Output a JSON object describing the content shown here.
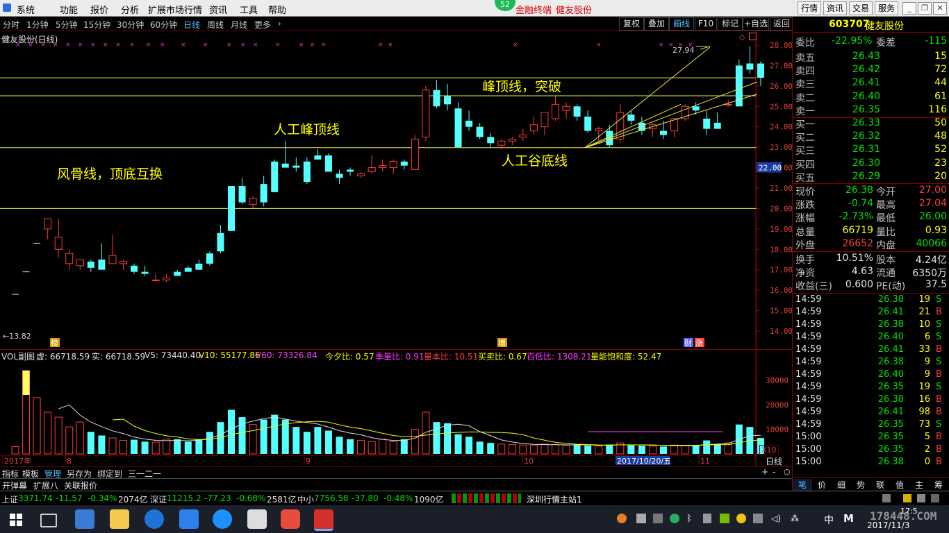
{
  "menu": {
    "items": [
      "系统",
      "功能",
      "报价",
      "分析",
      "扩展市场行情",
      "资讯",
      "工具",
      "帮助"
    ],
    "badge": "52",
    "center_items": [
      "金融终端",
      "健友股份"
    ],
    "right_buttons": [
      "行情",
      "资讯",
      "交易",
      "服务"
    ]
  },
  "period_bar": {
    "items": [
      "分时",
      "1分钟",
      "5分钟",
      "15分钟",
      "30分钟",
      "60分钟",
      "日线",
      "周线",
      "月线",
      "更多"
    ],
    "active": "日线",
    "right_buttons": [
      "复权",
      "叠加",
      "画线",
      "F10",
      "标记",
      "+自选",
      "返回"
    ]
  },
  "chart": {
    "title": "健友股份(日线)",
    "high_label": "27.94",
    "low_label": "13.82",
    "current_price_tag": "22.00",
    "price_axis": [
      "28.00",
      "27.00",
      "26.00",
      "25.00",
      "24.00",
      "23.00",
      "22.00",
      "21.00",
      "20.00",
      "19.00",
      "18.00",
      "17.00",
      "16.00",
      "15.00",
      "14.00"
    ],
    "annotations": [
      "人工峰顶线",
      "峰顶线，突破",
      "人工谷底线",
      "风骨线，顶底互换"
    ],
    "marker_labels": [
      "榜",
      "增",
      "财",
      "涨"
    ]
  },
  "chart_data": {
    "type": "candlestick",
    "price_range": [
      13.82,
      28.3
    ],
    "candles": [
      [
        15.8,
        15.8,
        15.8,
        15.8
      ],
      [
        16.9,
        16.9,
        16.9,
        16.9
      ],
      [
        18.3,
        18.3,
        18.3,
        18.3
      ],
      [
        19.0,
        19.5,
        18.5,
        19.5
      ],
      [
        18.0,
        19.5,
        17.6,
        18.6
      ],
      [
        17.3,
        18.0,
        17.0,
        17.8
      ],
      [
        17.2,
        17.5,
        17.0,
        17.5
      ],
      [
        17.4,
        17.5,
        16.9,
        17.1
      ],
      [
        17.5,
        18.3,
        17.2,
        17.0
      ],
      [
        17.3,
        18.7,
        17.3,
        17.7
      ],
      [
        17.3,
        17.5,
        17.0,
        17.4
      ],
      [
        17.2,
        17.3,
        16.8,
        16.9
      ],
      [
        16.9,
        17.2,
        16.7,
        16.8
      ],
      [
        16.5,
        16.8,
        16.4,
        16.5
      ],
      [
        16.5,
        16.8,
        16.4,
        16.6
      ],
      [
        16.9,
        17.0,
        16.7,
        16.7
      ],
      [
        17.1,
        17.2,
        16.9,
        16.9
      ],
      [
        17.3,
        17.5,
        17.0,
        17.0
      ],
      [
        17.8,
        17.9,
        17.2,
        17.3
      ],
      [
        18.8,
        19.2,
        17.8,
        17.9
      ],
      [
        21.1,
        21.1,
        18.9,
        18.9
      ],
      [
        21.1,
        21.5,
        20.2,
        20.3
      ],
      [
        20.2,
        20.6,
        20.0,
        20.5
      ],
      [
        21.2,
        21.6,
        20.1,
        20.3
      ],
      [
        22.3,
        22.4,
        20.8,
        20.8
      ],
      [
        22.2,
        23.3,
        22.0,
        22.0
      ],
      [
        22.1,
        22.5,
        21.8,
        22.0
      ],
      [
        22.3,
        22.5,
        21.2,
        21.3
      ],
      [
        22.6,
        22.9,
        22.4,
        22.4
      ],
      [
        22.6,
        22.7,
        21.8,
        21.8
      ],
      [
        21.7,
        21.9,
        21.2,
        21.5
      ],
      [
        21.9,
        22.0,
        21.6,
        21.8
      ],
      [
        21.6,
        21.8,
        21.5,
        21.7
      ],
      [
        21.8,
        22.6,
        21.7,
        22.0
      ],
      [
        22.0,
        22.4,
        21.8,
        22.1
      ],
      [
        22.0,
        22.4,
        21.7,
        22.3
      ],
      [
        22.3,
        22.4,
        21.9,
        22.1
      ],
      [
        21.9,
        23.6,
        21.9,
        23.4
      ],
      [
        23.5,
        26.0,
        23.3,
        25.8
      ],
      [
        25.8,
        26.3,
        24.9,
        25.0
      ],
      [
        25.5,
        26.1,
        24.8,
        25.1
      ],
      [
        24.9,
        25.2,
        23.9,
        23.0
      ],
      [
        24.3,
        24.8,
        23.8,
        24.0
      ],
      [
        24.0,
        24.2,
        23.4,
        23.5
      ],
      [
        23.5,
        23.7,
        23.0,
        23.2
      ],
      [
        23.1,
        23.4,
        22.9,
        23.3
      ],
      [
        23.3,
        23.5,
        23.1,
        23.4
      ],
      [
        23.5,
        23.9,
        23.3,
        23.6
      ],
      [
        23.8,
        24.5,
        23.6,
        24.1
      ],
      [
        24.0,
        24.2,
        23.6,
        24.7
      ],
      [
        24.4,
        25.5,
        24.3,
        25.1
      ],
      [
        24.8,
        25.2,
        24.4,
        25.0
      ],
      [
        25.0,
        25.1,
        24.3,
        24.5
      ],
      [
        24.5,
        24.8,
        23.7,
        23.8
      ],
      [
        23.8,
        24.0,
        23.3,
        23.9
      ],
      [
        23.8,
        24.1,
        23.0,
        23.1
      ],
      [
        23.4,
        25.1,
        23.2,
        24.7
      ],
      [
        24.6,
        24.8,
        24.1,
        24.3
      ],
      [
        24.2,
        24.5,
        23.6,
        23.8
      ],
      [
        23.9,
        24.2,
        23.5,
        24.1
      ],
      [
        23.8,
        24.3,
        23.4,
        23.6
      ],
      [
        23.8,
        24.2,
        23.5,
        24.4
      ],
      [
        24.4,
        25.1,
        24.3,
        25.0
      ],
      [
        25.0,
        25.2,
        24.6,
        24.8
      ],
      [
        24.4,
        24.8,
        23.6,
        23.9
      ],
      [
        24.2,
        24.7,
        24.0,
        23.9
      ],
      [
        25.1,
        25.3,
        25.0,
        25.1
      ],
      [
        27.0,
        27.3,
        25.1,
        25.0
      ],
      [
        27.1,
        27.94,
        26.6,
        26.8
      ],
      [
        27.1,
        27.2,
        26.0,
        26.4
      ]
    ],
    "volumes": [
      3000,
      34000,
      23000,
      17000,
      15000,
      11000,
      13000,
      9000,
      7500,
      6500,
      5500,
      5800,
      5000,
      4800,
      6000,
      6000,
      5000,
      6000,
      9000,
      13000,
      18000,
      15000,
      12000,
      14000,
      16000,
      14000,
      11000,
      9000,
      11000,
      9500,
      7000,
      6000,
      5500,
      5000,
      6000,
      5000,
      6000,
      10000,
      17000,
      13000,
      12500,
      8000,
      7000,
      5000,
      4500,
      4000,
      3800,
      3600,
      3500,
      4000,
      3800,
      3500,
      3700,
      3400,
      3200,
      3800,
      4500,
      3500,
      3300,
      3200,
      3000,
      3600,
      3400,
      3500,
      5500,
      4000,
      4500,
      12000,
      11000,
      6500
    ],
    "vol_axis": [
      "30000",
      "20000",
      "10000"
    ],
    "x_dates": [
      "2017年",
      "8",
      "9",
      "10",
      "11"
    ],
    "selected_date": "2017/10/20/五"
  },
  "vol_panel": {
    "title": "VOL副图",
    "stats": [
      {
        "label": "虚: 66718.59",
        "color": "#e0e0e0"
      },
      {
        "label": "实: 66718.59",
        "color": "#e0e0e0"
      },
      {
        "label": "V5: 73440.40",
        "color": "#e0e0e0"
      },
      {
        "label": "V10: 55177.86",
        "color": "#ffff00"
      },
      {
        "label": "V60: 73326.84",
        "color": "#ff40ff"
      },
      {
        "label": "今夕比: 0.57",
        "color": "#ffff00"
      },
      {
        "label": "季量比: 0.91",
        "color": "#ff40ff"
      },
      {
        "label": "量本比: 10.51",
        "color": "#ff3c3c"
      },
      {
        "label": "买卖比: 0.67",
        "color": "#ffff00"
      },
      {
        "label": "百低比: 1308.21",
        "color": "#ff40ff"
      },
      {
        "label": "量能饱和度: 52.47",
        "color": "#ffff00"
      }
    ],
    "x10": "X10",
    "period": "日线"
  },
  "sub_tabs": [
    "指标",
    "模板",
    "管理",
    "另存为",
    "绑定到",
    "三一二一"
  ],
  "bottom_tabs": [
    "开弹幕",
    "扩展八",
    "关联报价"
  ],
  "quote": {
    "code": "603707",
    "name": "健友股份",
    "weibi": {
      "label": "委比",
      "value": "-22.95%",
      "label2": "委差",
      "value2": "-115"
    },
    "asks": [
      {
        "label": "卖五",
        "price": "26.43",
        "vol": "15"
      },
      {
        "label": "卖四",
        "price": "26.42",
        "vol": "72"
      },
      {
        "label": "卖三",
        "price": "26.41",
        "vol": "44"
      },
      {
        "label": "卖二",
        "price": "26.40",
        "vol": "61"
      },
      {
        "label": "卖一",
        "price": "26.35",
        "vol": "116"
      }
    ],
    "bids": [
      {
        "label": "买一",
        "price": "26.33",
        "vol": "50"
      },
      {
        "label": "买二",
        "price": "26.32",
        "vol": "48"
      },
      {
        "label": "买三",
        "price": "26.31",
        "vol": "52"
      },
      {
        "label": "买四",
        "price": "26.30",
        "vol": "23"
      },
      {
        "label": "买五",
        "price": "26.29",
        "vol": "20"
      }
    ],
    "stats": [
      {
        "l1": "现价",
        "v1": "26.38",
        "c1": "green",
        "l2": "今开",
        "v2": "27.00",
        "c2": "red"
      },
      {
        "l1": "涨跌",
        "v1": "-0.74",
        "c1": "green",
        "l2": "最高",
        "v2": "27.04",
        "c2": "red"
      },
      {
        "l1": "涨幅",
        "v1": "-2.73%",
        "c1": "green",
        "l2": "最低",
        "v2": "26.00",
        "c2": "green"
      },
      {
        "l1": "总量",
        "v1": "66719",
        "c1": "yellow",
        "l2": "量比",
        "v2": "0.93",
        "c2": "yellow"
      },
      {
        "l1": "外盘",
        "v1": "26652",
        "c1": "red",
        "l2": "内盘",
        "v2": "40066",
        "c2": "green"
      }
    ],
    "fundamentals": [
      {
        "l1": "换手",
        "v1": "10.51%",
        "l2": "股本",
        "v2": "4.24亿"
      },
      {
        "l1": "净资",
        "v1": "4.63",
        "l2": "流通",
        "v2": "6350万"
      },
      {
        "l1": "收益(三)",
        "v1": "0.600",
        "l2": "PE(动)",
        "v2": "37.5"
      }
    ],
    "ticks": [
      {
        "t": "14:59",
        "p": "26.38",
        "pc": "green",
        "q": "19",
        "f": "S"
      },
      {
        "t": "14:59",
        "p": "26.41",
        "pc": "green",
        "q": "21",
        "f": "B"
      },
      {
        "t": "14:59",
        "p": "26.38",
        "pc": "green",
        "q": "10",
        "f": "S"
      },
      {
        "t": "14:59",
        "p": "26.40",
        "pc": "green",
        "q": "6",
        "f": "S"
      },
      {
        "t": "14:59",
        "p": "26.41",
        "pc": "green",
        "q": "33",
        "f": "B"
      },
      {
        "t": "14:59",
        "p": "26.38",
        "pc": "green",
        "q": "9",
        "f": "S"
      },
      {
        "t": "14:59",
        "p": "26.40",
        "pc": "green",
        "q": "9",
        "f": "B"
      },
      {
        "t": "14:59",
        "p": "26.35",
        "pc": "green",
        "q": "19",
        "f": "S"
      },
      {
        "t": "14:59",
        "p": "26.38",
        "pc": "green",
        "q": "16",
        "f": "B"
      },
      {
        "t": "14:59",
        "p": "26.41",
        "pc": "green",
        "q": "98",
        "f": "B"
      },
      {
        "t": "14:59",
        "p": "26.35",
        "pc": "green",
        "q": "73",
        "f": "S"
      },
      {
        "t": "15:00",
        "p": "26.35",
        "pc": "green",
        "q": "5",
        "f": "B"
      },
      {
        "t": "15:00",
        "p": "26.35",
        "pc": "green",
        "q": "2",
        "f": "B"
      },
      {
        "t": "15:00",
        "p": "26.38",
        "pc": "green",
        "q": "0",
        "f": "B"
      }
    ],
    "panel_tabs": [
      "笔",
      "价",
      "细",
      "势",
      "联",
      "值",
      "主",
      "筹"
    ]
  },
  "status": {
    "items": [
      {
        "label": "上证",
        "value": "3371.74",
        "chg": "-11.57",
        "pct": "-0.34%",
        "amt": "2074亿"
      },
      {
        "label": "深证",
        "value": "11215.2",
        "chg": "-77.23",
        "pct": "-0.68%",
        "amt": "2581亿"
      },
      {
        "label": "中小",
        "value": "7756.58",
        "chg": "-37.80",
        "pct": "-0.48%",
        "amt": "1090亿"
      }
    ],
    "station": "深圳行情主站1"
  },
  "taskbar": {
    "ime": "中",
    "clock_time": "17:5",
    "clock_date": "2017/11/3",
    "watermark": "178448.COM"
  }
}
